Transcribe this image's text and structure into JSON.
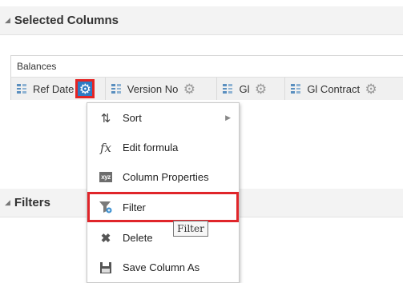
{
  "selected_columns": {
    "title": "Selected Columns"
  },
  "balances": {
    "title": "Balances",
    "columns": [
      {
        "label": "Ref Date",
        "active": true
      },
      {
        "label": "Version No"
      },
      {
        "label": "Gl"
      },
      {
        "label": "Gl Contract"
      }
    ]
  },
  "filters": {
    "title": "Filters"
  },
  "menu": {
    "items": [
      {
        "label": "Sort",
        "icon": "sort-icon",
        "glyph": "⇅",
        "has_submenu": true
      },
      {
        "label": "Edit formula",
        "icon": "fx-icon",
        "glyph": "fx"
      },
      {
        "label": "Column Properties",
        "icon": "xyz-icon",
        "glyph": "xyz"
      },
      {
        "label": "Filter",
        "icon": "filter-icon",
        "glyph": "⏷",
        "highlighted": true
      },
      {
        "label": "Delete",
        "icon": "delete-icon",
        "glyph": "✖"
      },
      {
        "label": "Save Column As",
        "icon": "save-icon",
        "glyph": "💾"
      }
    ]
  },
  "tooltip": {
    "text": "Filter"
  },
  "colors": {
    "highlight_red": "#e0252a",
    "active_gear_blue": "#2e7ac4",
    "column_icon_blue": "#5a8fbf"
  }
}
